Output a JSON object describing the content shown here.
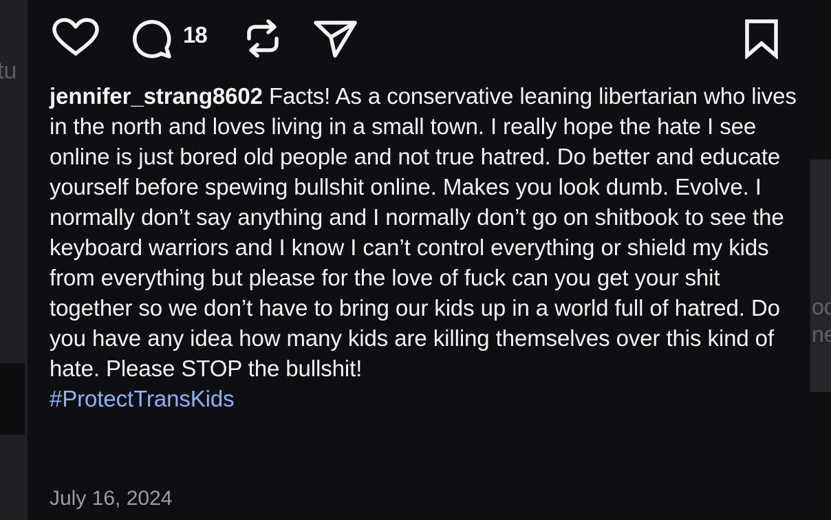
{
  "post": {
    "actions": {
      "like_icon": "heart-icon",
      "comment_icon": "comment-icon",
      "comment_count": "18",
      "repost_icon": "repost-icon",
      "share_icon": "send-icon",
      "save_icon": "bookmark-icon"
    },
    "caption": {
      "username": "jennifer_strang8602",
      "text": "Facts! As a conservative leaning libertarian who lives in the north and loves living in a small town. I really hope the hate I see online is just bored old people and not true hatred. Do better and educate yourself before spewing bullshit online. Makes you look dumb. Evolve. I normally don’t say anything and I normally don’t go on shitbook to see the keyboard warriors and I know I can’t control everything or shield my kids from everything but please for the love of fuck can you get your shit together so we don’t have to bring our kids up in a world full of hatred. Do you have any idea how many kids are killing themselves over this kind of hate. Please STOP the bullshit!",
      "hashtag": "#ProtectTransKids"
    },
    "date": "July 16, 2024"
  },
  "background": {
    "left_fragment": "tu",
    "right_fragment_1": "od",
    "right_fragment_2": "ne"
  },
  "colors": {
    "panel": "#0d0f12",
    "text": "#f3f3f3",
    "hashtag": "#8fb2f7",
    "date": "#9a9ca0"
  }
}
